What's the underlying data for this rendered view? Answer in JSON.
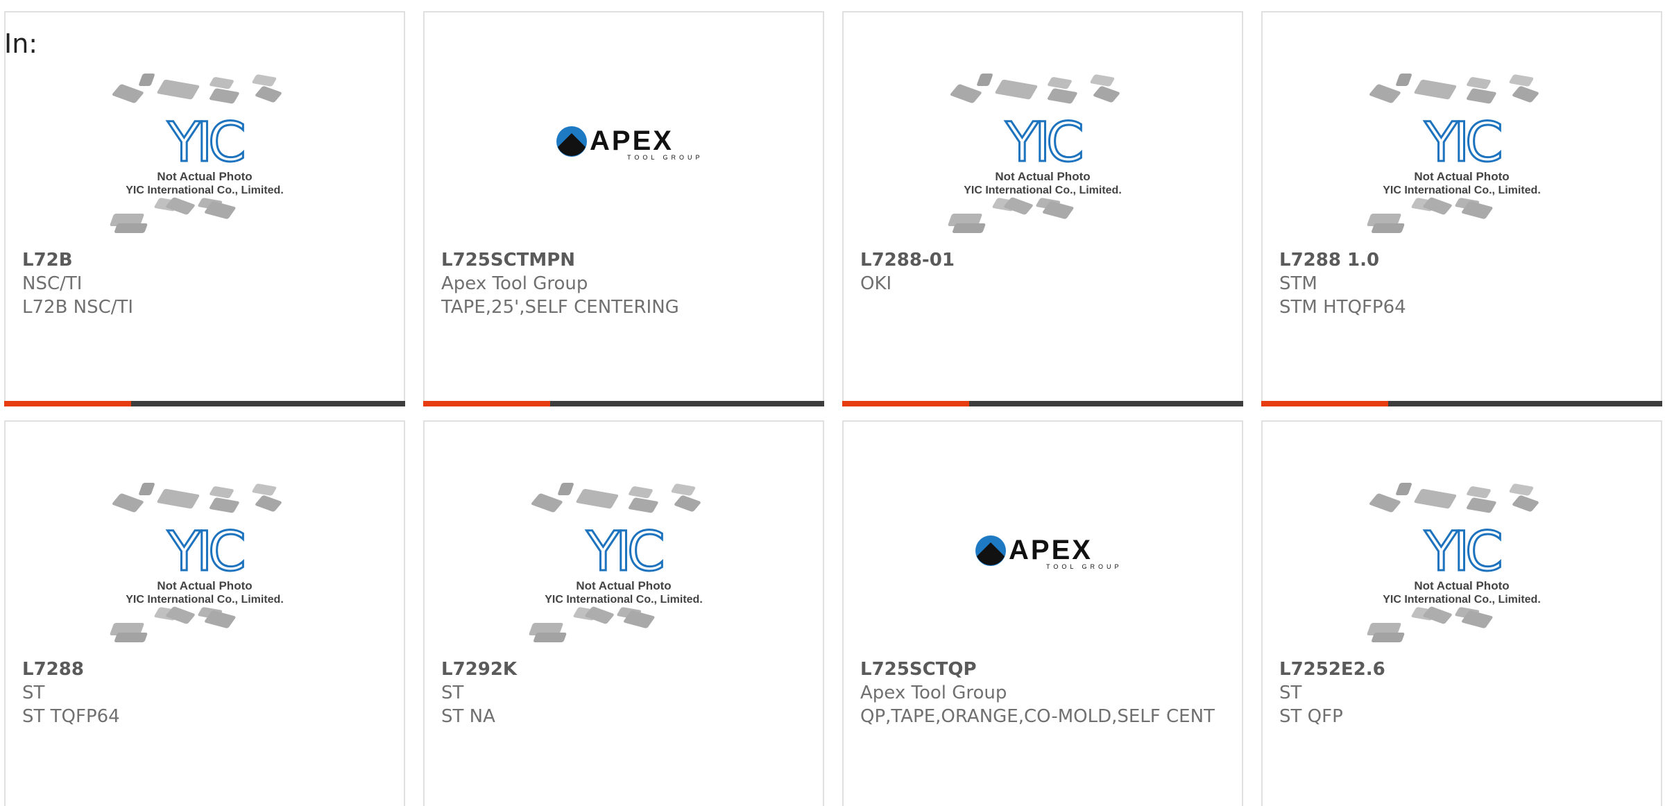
{
  "filter": {
    "label": "In:"
  },
  "colors": {
    "accent": "#e63c0f",
    "bar": "#3d3d3d",
    "border": "#e0e0e0",
    "text": "#707070",
    "yic_blue": "#1e73be"
  },
  "placeholder": {
    "line1": "Not Actual Photo",
    "line2": "YIC International Co., Limited.",
    "logo": "YIC"
  },
  "apex_logo": {
    "name": "APEX",
    "tagline": "TOOL GROUP"
  },
  "products": [
    {
      "part": "L72B",
      "maker": "NSC/TI",
      "desc": "L72B NSC/TI",
      "image": "yic-placeholder"
    },
    {
      "part": "L725SCTMPN",
      "maker": "Apex Tool Group",
      "desc": "TAPE,25',SELF CENTERING",
      "image": "apex-logo"
    },
    {
      "part": "L7288-01",
      "maker": "OKI",
      "desc": "",
      "image": "yic-placeholder"
    },
    {
      "part": "L7288 1.0",
      "maker": "STM",
      "desc": "STM HTQFP64",
      "image": "yic-placeholder"
    },
    {
      "part": "L7288",
      "maker": "ST",
      "desc": "ST TQFP64",
      "image": "yic-placeholder"
    },
    {
      "part": "L7292K",
      "maker": "ST",
      "desc": "ST NA",
      "image": "yic-placeholder"
    },
    {
      "part": "L725SCTQP",
      "maker": "Apex Tool Group",
      "desc": "QP,TAPE,ORANGE,CO-MOLD,SELF CENT",
      "image": "apex-logo"
    },
    {
      "part": "L7252E2.6",
      "maker": "ST",
      "desc": "ST QFP",
      "image": "yic-placeholder"
    }
  ]
}
